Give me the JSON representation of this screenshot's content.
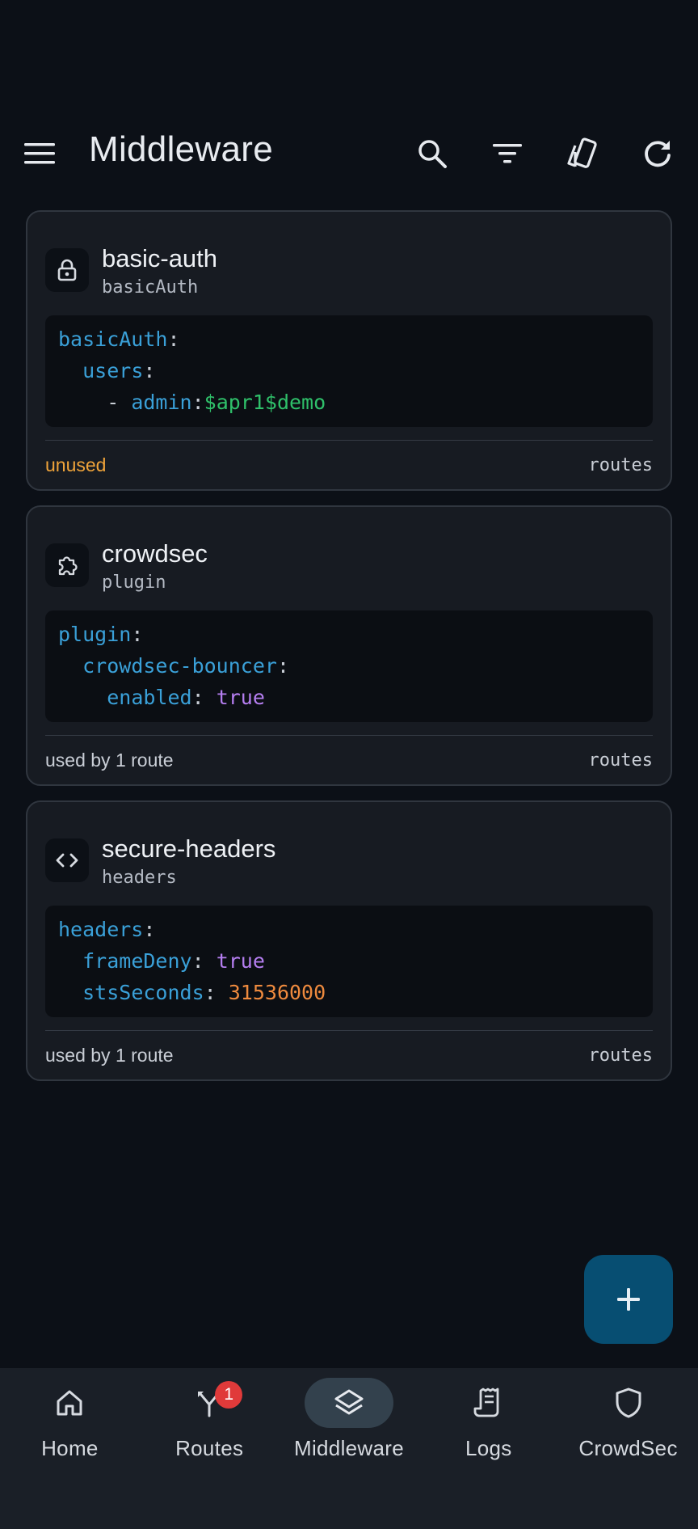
{
  "header": {
    "title": "Middleware",
    "actions": [
      {
        "icon": "search-icon"
      },
      {
        "icon": "filter-icon"
      },
      {
        "icon": "theme-cards-icon"
      },
      {
        "icon": "refresh-icon"
      }
    ]
  },
  "middlewares": [
    {
      "name": "basic-auth",
      "type": "basicAuth",
      "icon": "lock-icon",
      "config_lines": [
        [
          {
            "c": "k",
            "t": "basicAuth"
          },
          {
            "c": "p",
            "t": ":"
          }
        ],
        [
          {
            "c": "p",
            "t": "  "
          },
          {
            "c": "k",
            "t": "users"
          },
          {
            "c": "p",
            "t": ":"
          }
        ],
        [
          {
            "c": "p",
            "t": "    - "
          },
          {
            "c": "k",
            "t": "admin"
          },
          {
            "c": "p",
            "t": ":"
          },
          {
            "c": "s",
            "t": "$apr1$demo"
          }
        ]
      ],
      "usage": "unused",
      "usage_status": "warn",
      "routes_label": "routes"
    },
    {
      "name": "crowdsec",
      "type": "plugin",
      "icon": "puzzle-icon",
      "config_lines": [
        [
          {
            "c": "k",
            "t": "plugin"
          },
          {
            "c": "p",
            "t": ":"
          }
        ],
        [
          {
            "c": "p",
            "t": "  "
          },
          {
            "c": "k",
            "t": "crowdsec-bouncer"
          },
          {
            "c": "p",
            "t": ":"
          }
        ],
        [
          {
            "c": "p",
            "t": "    "
          },
          {
            "c": "k",
            "t": "enabled"
          },
          {
            "c": "p",
            "t": ": "
          },
          {
            "c": "b",
            "t": "true"
          }
        ]
      ],
      "usage": "used by 1 route",
      "usage_status": "normal",
      "routes_label": "routes"
    },
    {
      "name": "secure-headers",
      "type": "headers",
      "icon": "code-icon",
      "config_lines": [
        [
          {
            "c": "k",
            "t": "headers"
          },
          {
            "c": "p",
            "t": ":"
          }
        ],
        [
          {
            "c": "p",
            "t": "  "
          },
          {
            "c": "k",
            "t": "frameDeny"
          },
          {
            "c": "p",
            "t": ": "
          },
          {
            "c": "b",
            "t": "true"
          }
        ],
        [
          {
            "c": "p",
            "t": "  "
          },
          {
            "c": "k",
            "t": "stsSeconds"
          },
          {
            "c": "p",
            "t": ": "
          },
          {
            "c": "n",
            "t": "31536000"
          }
        ]
      ],
      "usage": "used by 1 route",
      "usage_status": "normal",
      "routes_label": "routes"
    }
  ],
  "fab": {
    "icon": "plus-icon"
  },
  "bottom_nav": [
    {
      "label": "Home",
      "icon": "home-icon",
      "active": false
    },
    {
      "label": "Routes",
      "icon": "routes-icon",
      "active": false,
      "badge": "1"
    },
    {
      "label": "Middleware",
      "icon": "layers-icon",
      "active": true
    },
    {
      "label": "Logs",
      "icon": "receipt-icon",
      "active": false
    },
    {
      "label": "CrowdSec",
      "icon": "shield-icon",
      "active": false
    }
  ],
  "colors": {
    "background": "#0c1017",
    "card": "#171b22",
    "key": "#3aa0d8",
    "string": "#2fc06a",
    "boolean": "#b57ef0",
    "number": "#ee8a3e",
    "warning": "#f0a43a",
    "fab": "#074e72",
    "badge": "#e03a3a"
  }
}
